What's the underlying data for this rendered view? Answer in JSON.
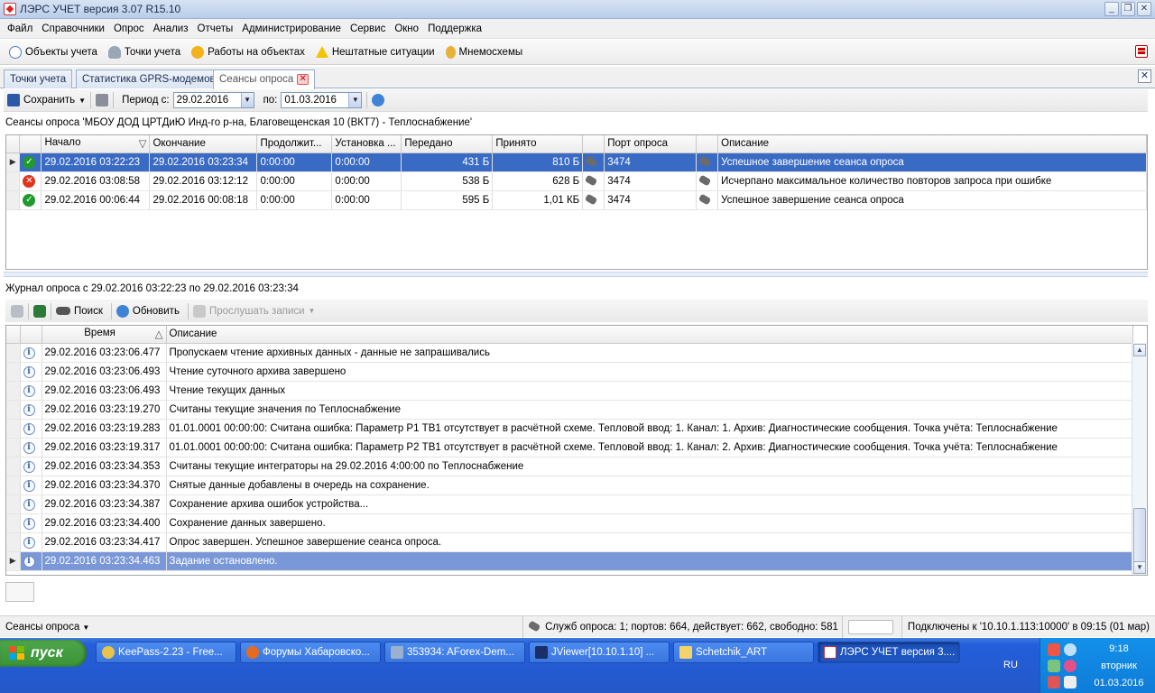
{
  "window": {
    "title": "ЛЭРС УЧЕТ версия 3.07 R15.10"
  },
  "menu": [
    "Файл",
    "Справочники",
    "Опрос",
    "Анализ",
    "Отчеты",
    "Администрирование",
    "Сервис",
    "Окно",
    "Поддержка"
  ],
  "main_toolbar": [
    {
      "label": "Объекты учета",
      "icon": "objects-icon"
    },
    {
      "label": "Точки учета",
      "icon": "meter-points-icon"
    },
    {
      "label": "Работы на объектах",
      "icon": "works-icon"
    },
    {
      "label": "Нештатные ситуации",
      "icon": "warning-icon"
    },
    {
      "label": "Мнемосхемы",
      "icon": "mnemonic-icon"
    }
  ],
  "tabs": [
    {
      "label": "Точки учета",
      "active": false
    },
    {
      "label": "Статистика GPRS-модемов",
      "active": false
    },
    {
      "label": "Сеансы опроса",
      "active": true
    }
  ],
  "session_toolbar": {
    "save_label": "Сохранить",
    "period_label": "Период с:",
    "date_from": "29.02.2016",
    "to_label": "по:",
    "date_to": "01.03.2016"
  },
  "sessions": {
    "caption": "Сеансы опроса 'МБОУ ДОД ЦРТДиЮ Инд-го р-на, Благовещенская 10 (ВКТ7) - Теплоснабжение'",
    "columns": [
      "Начало",
      "Окончание",
      "Продолжит...",
      "Установка ...",
      "Передано",
      "Принято",
      "",
      "Порт опроса",
      "",
      "Описание"
    ],
    "rows": [
      {
        "status": "ok",
        "start": "29.02.2016 03:22:23",
        "end": "29.02.2016 03:23:34",
        "duration": "0:00:00",
        "setup": "0:00:00",
        "sent": "431 Б",
        "received": "810 Б",
        "port": "3474",
        "description": "Успешное завершение сеанса опроса",
        "selected": true
      },
      {
        "status": "error",
        "start": "29.02.2016 03:08:58",
        "end": "29.02.2016 03:12:12",
        "duration": "0:00:00",
        "setup": "0:00:00",
        "sent": "538 Б",
        "received": "628 Б",
        "port": "3474",
        "description": "Исчерпано максимальное количество повторов запроса при ошибке",
        "selected": false
      },
      {
        "status": "ok",
        "start": "29.02.2016 00:06:44",
        "end": "29.02.2016 00:08:18",
        "duration": "0:00:00",
        "setup": "0:00:00",
        "sent": "595 Б",
        "received": "1,01 КБ",
        "port": "3474",
        "description": "Успешное завершение сеанса опроса",
        "selected": false
      }
    ]
  },
  "journal": {
    "caption": "Журнал опроса с 29.02.2016 03:22:23 по 29.02.2016 03:23:34",
    "toolbar": {
      "search_label": "Поиск",
      "refresh_label": "Обновить",
      "listen_label": "Прослушать записи"
    },
    "columns": [
      "Время",
      "Описание"
    ],
    "rows": [
      {
        "time": "29.02.2016 03:23:06.477",
        "text": "Пропускаем чтение архивных данных - данные не запрашивались"
      },
      {
        "time": "29.02.2016 03:23:06.493",
        "text": "Чтение суточного архива завершено"
      },
      {
        "time": "29.02.2016 03:23:06.493",
        "text": "Чтение текущих данных"
      },
      {
        "time": "29.02.2016 03:23:19.270",
        "text": "Считаны текущие значения по Теплоснабжение"
      },
      {
        "time": "29.02.2016 03:23:19.283",
        "text": "01.01.0001 00:00:00: Считана ошибка: Параметр P1 ТВ1 отсутствует в расчётной схеме. Тепловой ввод: 1. Канал: 1. Архив: Диагностические сообщения. Точка учёта: Теплоснабжение"
      },
      {
        "time": "29.02.2016 03:23:19.317",
        "text": "01.01.0001 00:00:00: Считана ошибка: Параметр P2 ТВ1 отсутствует в расчётной схеме. Тепловой ввод: 1. Канал: 2. Архив: Диагностические сообщения. Точка учёта: Теплоснабжение"
      },
      {
        "time": "29.02.2016 03:23:34.353",
        "text": "Считаны текущие интеграторы на 29.02.2016 4:00:00 по Теплоснабжение"
      },
      {
        "time": "29.02.2016 03:23:34.370",
        "text": "Снятые данные добавлены в очередь на сохранение."
      },
      {
        "time": "29.02.2016 03:23:34.387",
        "text": "Сохранение архива ошибок устройства..."
      },
      {
        "time": "29.02.2016 03:23:34.400",
        "text": "Сохранение данных завершено."
      },
      {
        "time": "29.02.2016 03:23:34.417",
        "text": "Опрос завершен. Успешное завершение сеанса опроса."
      },
      {
        "time": "29.02.2016 03:23:34.463",
        "text": "Задание остановлено."
      }
    ]
  },
  "statusbar": {
    "sessions_label": "Сеансы опроса",
    "services": "Служб опроса: 1; портов: 664, действует: 662, свободно: 581",
    "connection": "Подключены к '10.10.1.113:10000' в 09:15 (01 мар)"
  },
  "taskbar": {
    "start_label": "пуск",
    "tasks": [
      "KeePass-2.23 - Free...",
      "Форумы Хабаровско...",
      "353934: AForex-Dem...",
      "JViewer[10.10.1.10] ...",
      "Schetchik_ART",
      "ЛЭРС УЧЕТ версия 3...."
    ],
    "language": "RU",
    "clock_time": "9:18",
    "clock_day": "вторник",
    "clock_date": "01.03.2016"
  },
  "colors": {
    "selection": "#3a6bc4",
    "selection_inactive": "#7a98d8",
    "taskbar": "#245edb",
    "start": "#3b9237"
  }
}
